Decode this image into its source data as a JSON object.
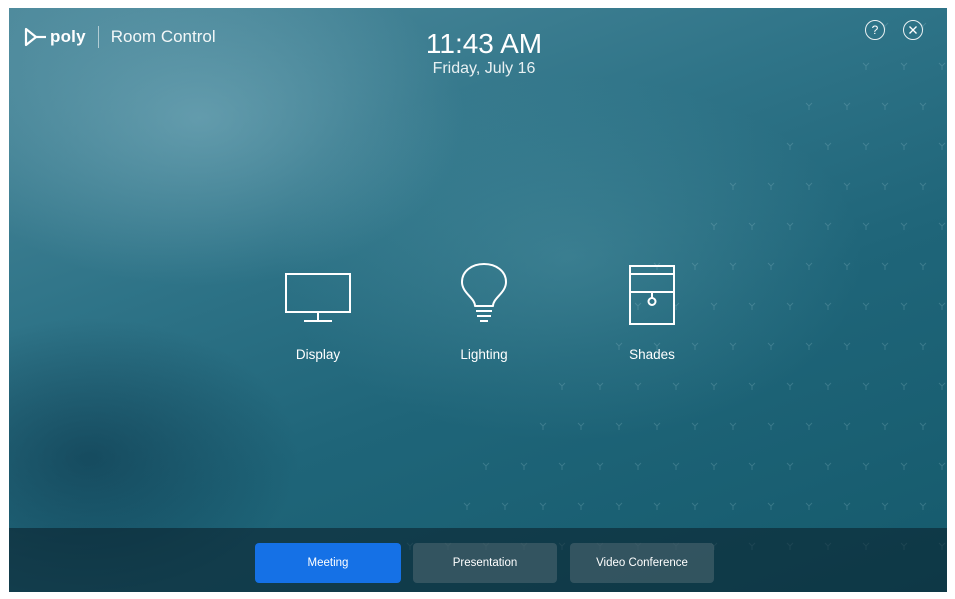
{
  "header": {
    "brand_name": "poly",
    "app_title": "Room Control",
    "time": "11:43 AM",
    "date": "Friday, July 16",
    "help_icon": "question-circle-icon",
    "close_icon": "close-circle-icon"
  },
  "controls": [
    {
      "label": "Display",
      "icon": "monitor-icon"
    },
    {
      "label": "Lighting",
      "icon": "lightbulb-icon"
    },
    {
      "label": "Shades",
      "icon": "shades-icon"
    }
  ],
  "modes": {
    "active": "Meeting",
    "tabs": [
      {
        "label": "Meeting"
      },
      {
        "label": "Presentation"
      },
      {
        "label": "Video Conference"
      }
    ]
  },
  "colors": {
    "accent": "#1571e6",
    "background": "#2f7488",
    "bottom_bar": "#0f2a35"
  }
}
